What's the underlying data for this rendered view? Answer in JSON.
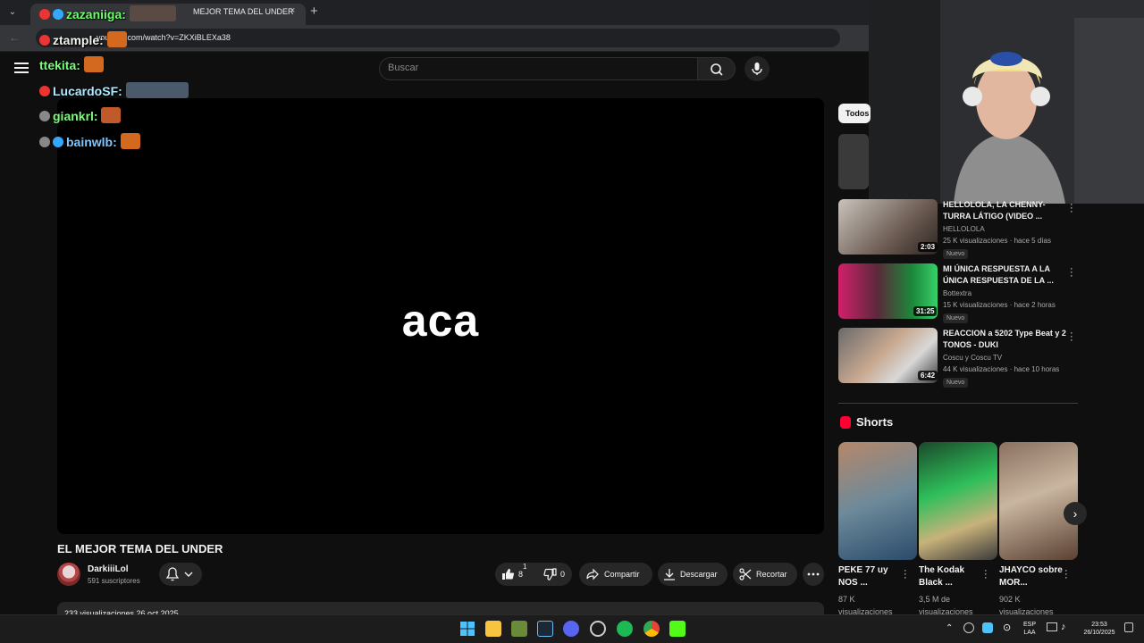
{
  "browser": {
    "tab_title": "MEJOR TEMA DEL UNDER",
    "tab_close": "×",
    "new_tab": "+",
    "back": "←",
    "url": "youtube.com/watch?v=ZKXiBLEXa38"
  },
  "youtube": {
    "search_placeholder": "Buscar",
    "player_text": "aca",
    "video_title": "EL MEJOR TEMA DEL UNDER",
    "channel_name": "DarkiiiLol",
    "channel_subs": "591 suscriptores",
    "like_count": "8",
    "like_notif": "1",
    "dislike_count": "0",
    "share_label": "Compartir",
    "download_label": "Descargar",
    "clip_label": "Recortar",
    "views_line": "233 visualizaciones  26 oct 2025"
  },
  "chat": [
    {
      "user": "zazaniiga:",
      "color": "#6cff6c",
      "badge_color": "#e33"
    },
    {
      "user": "ztample:",
      "color": "#f1f1f1",
      "badge_color": "#e33"
    },
    {
      "user": "ttekita:",
      "color": "#7cfc7c",
      "badge_color": "#e33"
    },
    {
      "user": "LucardoSF:",
      "color": "#aeeaff",
      "badge_color": "#e33"
    },
    {
      "user": "giankrl:",
      "color": "#7cfc7c",
      "badge_color": "#888"
    },
    {
      "user": "bainwlb:",
      "color": "#7fc6ff",
      "badge_color": "#888"
    }
  ],
  "sidebar": {
    "chip": "Todos",
    "recommendations": [
      {
        "title": "HELLOLOLA, LA CHENNY-TURRA LÁTIGO (VIDEO ...",
        "channel": "HELLOLOLA",
        "meta": "25 K visualizaciones · hace 5 días",
        "badge": "Nuevo",
        "duration": "2:03"
      },
      {
        "title": "MI ÚNICA RESPUESTA A LA ÚNICA RESPUESTA DE LA ...",
        "channel": "Bottextra",
        "meta": "15 K visualizaciones · hace 2 horas",
        "badge": "Nuevo",
        "duration": "31:25"
      },
      {
        "title": "REACCION a 5202 Type Beat y 2 TONOS - DUKI",
        "channel": "Coscu  y Coscu TV",
        "meta": "44 K visualizaciones · hace 10 horas",
        "badge": "Nuevo",
        "duration": "6:42"
      }
    ],
    "shorts_heading": "Shorts",
    "shorts": [
      {
        "title": "PEKE 77 uy NOS ...",
        "views": "87 K visualizaciones"
      },
      {
        "title": "The Kodak Black ...",
        "views": "3,5 M de visualizaciones"
      },
      {
        "title": "JHAYCO sobre MOR...",
        "views": "902 K visualizaciones"
      }
    ]
  },
  "taskbar": {
    "lang": "ESP",
    "lang2": "LAA",
    "time": "23:53",
    "date": "26/10/2025"
  },
  "colors": {
    "accent": "#ff0033",
    "background": "#0f0f0f"
  }
}
